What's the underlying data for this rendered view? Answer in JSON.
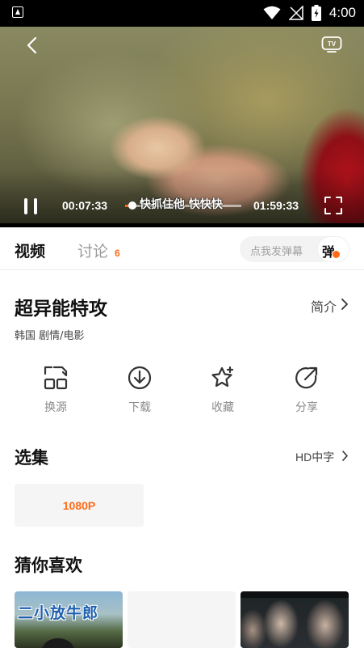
{
  "status_bar": {
    "time": "4:00"
  },
  "player": {
    "current_time": "00:07:33",
    "total_time": "01:59:33",
    "progress": 0.063,
    "danmaku_text": "快抓住他 快快快"
  },
  "tabs": {
    "video_label": "视频",
    "discuss_label": "讨论",
    "discuss_count": "6",
    "danmaku_placeholder": "点我发弹幕",
    "danmaku_toggle_label": "弹"
  },
  "movie": {
    "title": "超异能特攻",
    "intro_label": "简介",
    "meta": "韩国  剧情/电影"
  },
  "actions": [
    {
      "label": "换源",
      "icon": "switch-source-icon"
    },
    {
      "label": "下载",
      "icon": "download-icon"
    },
    {
      "label": "收藏",
      "icon": "favorite-star-icon"
    },
    {
      "label": "分享",
      "icon": "share-icon"
    }
  ],
  "episodes": {
    "section_title": "选集",
    "quality_label": "HD中字",
    "items": [
      {
        "label": "1080P"
      }
    ]
  },
  "recommendations": {
    "section_title": "猜你喜欢",
    "items": [
      {
        "poster_text": "二小放牛郎"
      },
      {
        "poster_text": ""
      },
      {
        "poster_text": ""
      }
    ]
  },
  "colors": {
    "accent": "#ff6a17",
    "text_primary": "#111111",
    "text_secondary": "#8a8a8a"
  }
}
